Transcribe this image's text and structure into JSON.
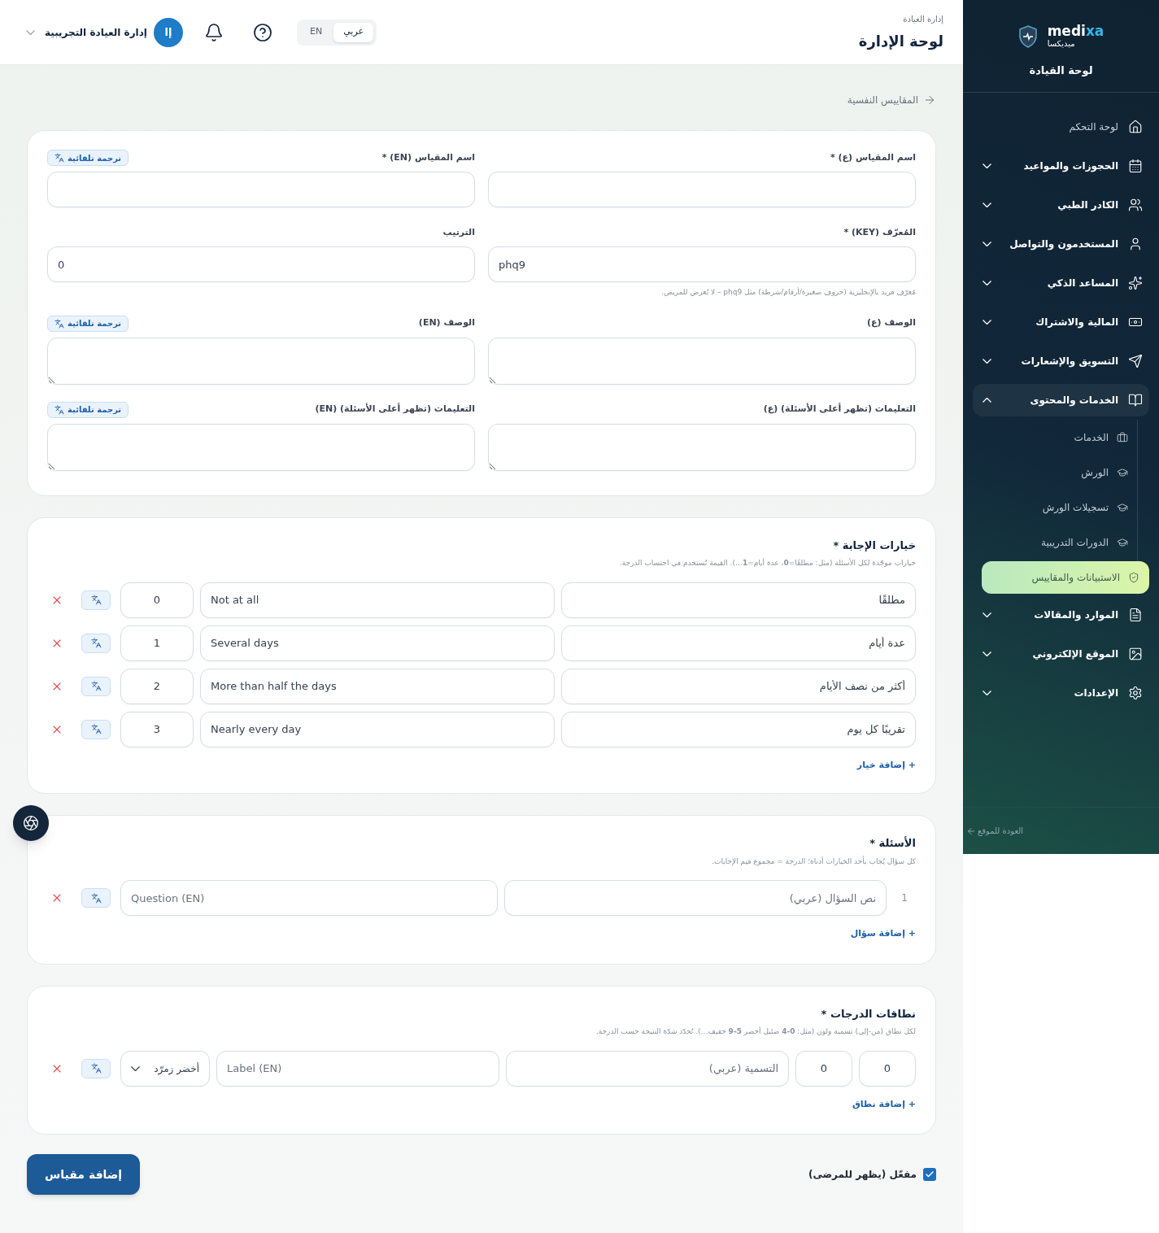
{
  "sidebar": {
    "brand": "medi",
    "brand_accent": "xa",
    "brand_ar": "ميديكسا",
    "title": "لوحة القيادة",
    "items": [
      {
        "kind": "link",
        "label": "لوحة التحكم"
      },
      {
        "kind": "group",
        "label": "الحجوزات والمواعيد",
        "expanded": false
      },
      {
        "kind": "group",
        "label": "الكادر الطبي",
        "expanded": false
      },
      {
        "kind": "group",
        "label": "المستخدمون والتواصل",
        "expanded": false
      },
      {
        "kind": "group",
        "label": "المساعد الذكي",
        "expanded": false
      },
      {
        "kind": "group",
        "label": "المالية والاشتراك",
        "expanded": false
      },
      {
        "kind": "group",
        "label": "التسويق والإشعارات",
        "expanded": false
      },
      {
        "kind": "group",
        "label": "الخدمات والمحتوى",
        "expanded": true,
        "children": [
          {
            "label": "الخدمات",
            "selected": false
          },
          {
            "label": "الورش",
            "selected": false
          },
          {
            "label": "تسجيلات الورش",
            "selected": false
          },
          {
            "label": "الدورات التدريبية",
            "selected": false
          },
          {
            "label": "الاستبيانات والمقاييس",
            "selected": true
          }
        ]
      },
      {
        "kind": "group",
        "label": "الموارد والمقالات",
        "expanded": false
      },
      {
        "kind": "group",
        "label": "الموقع الإلكتروني",
        "expanded": false
      },
      {
        "kind": "group",
        "label": "الإعدادات",
        "expanded": false
      }
    ],
    "back_link": "العودة للموقع"
  },
  "header": {
    "breadcrumb": "إدارة العيادة",
    "title": "لوحة الإدارة",
    "languages": [
      {
        "label": "عربي",
        "selected": true
      },
      {
        "label": "EN",
        "selected": false
      }
    ],
    "avatar": "إا",
    "user": "إدارة العيادة التجريبية"
  },
  "back_link": "المقاييس النفسية",
  "details": {
    "fields": [
      {
        "kind": "input",
        "label": "اسم المقياس (ع) *"
      },
      {
        "kind": "input",
        "label": "اسم المقياس (EN) *",
        "badge": "ترجمة تلقائية"
      },
      {
        "kind": "input",
        "label": "المُعرّف (KEY) *",
        "value": "phq9",
        "hint": "مُعرّف فريد بالإنجليزية (حروف صغيرة/أرقام/شرطة) مثل phq9 – لا يُعرض للمريض."
      },
      {
        "kind": "input",
        "label": "الترتيب",
        "value": "0"
      },
      {
        "kind": "textarea",
        "label": "الوصف (ع)"
      },
      {
        "kind": "textarea",
        "label": "الوصف (EN)",
        "badge": "ترجمة تلقائية"
      },
      {
        "kind": "textarea",
        "label": "التعليمات (تظهر أعلى الأسئلة) (ع)"
      },
      {
        "kind": "textarea",
        "label": "التعليمات (تظهر أعلى الأسئلة) (EN)",
        "badge": "ترجمة تلقائية"
      }
    ]
  },
  "answers": {
    "title": "خيارات الإجابة *",
    "hint": "خيارات موحّدة لكل الأسئلة (مثل: مطلقًا=**0**، عدة أيام=**1**…). القيمة تُستخدم في احتساب الدرجة.",
    "options": [
      {
        "ar": "مطلقًا",
        "en": "Not at all",
        "value": "0"
      },
      {
        "ar": "عدة أيام",
        "en": "Several days",
        "value": "1"
      },
      {
        "ar": "أكثر من نصف الأيام",
        "en": "More than half the days",
        "value": "2"
      },
      {
        "ar": "تقريبًا كل يوم",
        "en": "Nearly every day",
        "value": "3"
      }
    ],
    "add": "+ إضافة خيار"
  },
  "questions": {
    "title": "الأسئلة *",
    "hint": "كل سؤال يُجاب بأحد الخيارات أدناه؛ الدرجة = مجموع قيم الإجابات.",
    "items": [
      {
        "number": "1",
        "placeholder_ar": "نص السؤال (عربي)",
        "placeholder_en": "Question (EN)"
      }
    ],
    "add": "+ إضافة سؤال"
  },
  "ranges": {
    "title": "نطاقات الدرجات *",
    "hint": "لكل نطاق (من-إلى) تسمية ولون (مثل: **0-4** ضئيل أخضر **5-9** خفيف…). تُحدّد شدّة النتيجة حسب الدرجة.",
    "items": [
      {
        "from": "0",
        "to": "0",
        "placeholder_ar": "التسمية (عربي)",
        "placeholder_en": "Label (EN)",
        "color_option": "أخضر زمرّد"
      }
    ],
    "add": "+ إضافة نطاق"
  },
  "footer": {
    "active": {
      "label": "مفعّل (يظهر للمرضى)",
      "checked": true
    },
    "submit": "إضافة مقياس"
  }
}
